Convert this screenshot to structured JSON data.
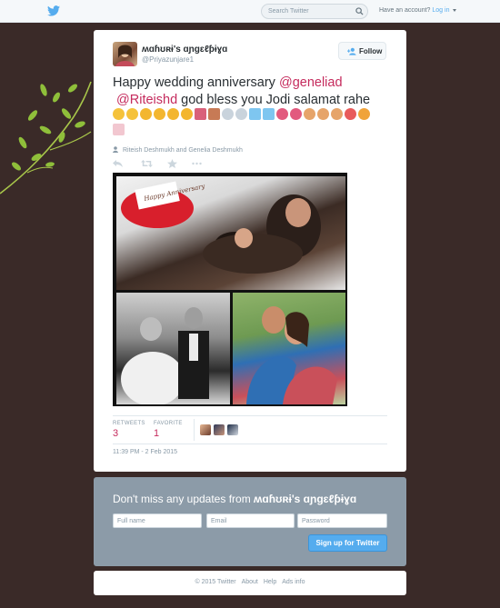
{
  "topbar": {
    "logo_icon": "twitter-bird-icon",
    "search_placeholder": "Search Twitter",
    "account_prompt": "Have an account?",
    "login_label": "Log in"
  },
  "tweet": {
    "author_name": "ʍɑɦʊʀɨ's ɑɲɡɛℓƥɨɣɑ",
    "author_handle": "@Priyazunjare1",
    "follow_label": "Follow",
    "text_part1": "Happy wedding anniversary ",
    "mention1": "@geneliad",
    "mention2": "@Riteishd",
    "text_part2": " god bless you Jodi salamat rahe",
    "tagged": "Riteish Deshmukh and Genelia Deshmukh",
    "photo_caption": "Happy Anniversary",
    "retweets_label": "RETWEETS",
    "retweets_count": "3",
    "favorites_label": "FAVORITE",
    "favorites_count": "1",
    "timestamp": "11:39 PM - 2 Feb 2015"
  },
  "signup": {
    "title_prefix": "Don't miss any updates from ",
    "title_name": "ʍɑɦʊʀɨ's ɑɲɡɛℓƥɨɣɑ",
    "fullname_placeholder": "Full name",
    "email_placeholder": "Email",
    "password_placeholder": "Password",
    "button_label": "Sign up for Twitter"
  },
  "footer": {
    "copyright": "© 2015 Twitter",
    "about": "About",
    "help": "Help",
    "ads": "Ads info"
  },
  "colors": {
    "background": "#3a2a28",
    "accent": "#55acee",
    "mention": "#c52b5d"
  }
}
